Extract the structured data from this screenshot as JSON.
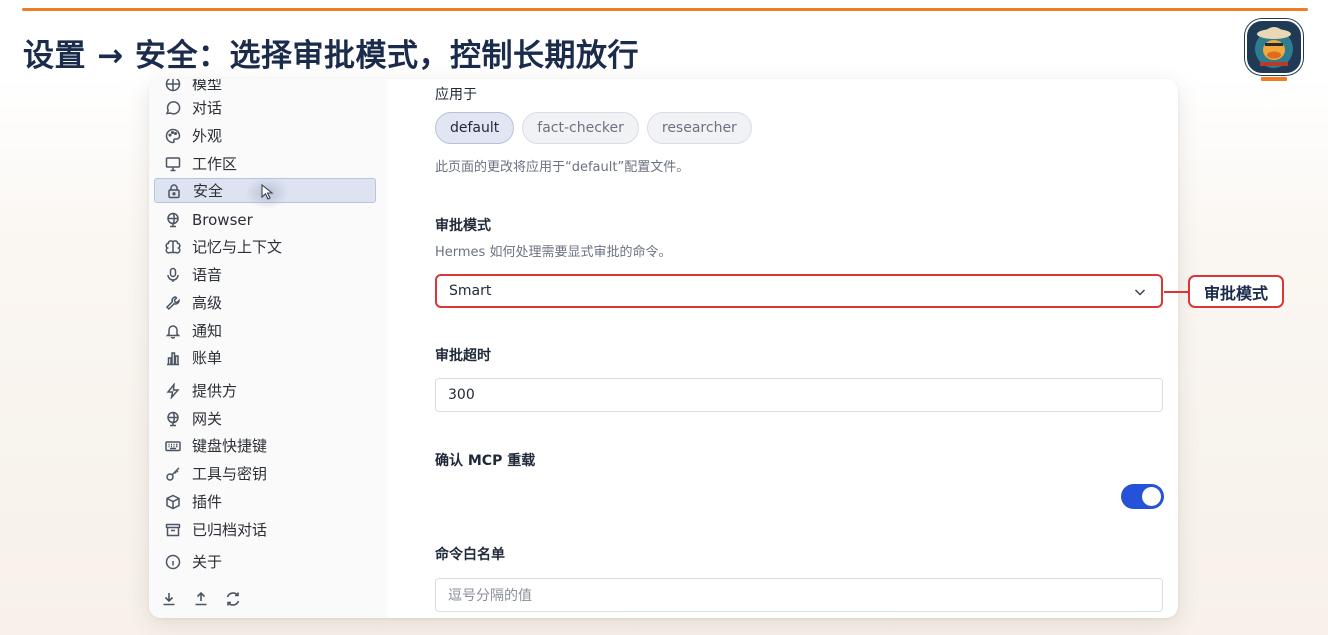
{
  "slide": {
    "title": "设置 → 安全：选择审批模式，控制长期放行",
    "accent_color": "#ee7d24",
    "callout_label": "审批模式",
    "callout_color": "#d93636"
  },
  "sidebar": {
    "items": [
      {
        "label": "模型",
        "icon": "model-icon"
      },
      {
        "label": "对话",
        "icon": "chat-bubble-icon"
      },
      {
        "label": "外观",
        "icon": "palette-icon"
      },
      {
        "label": "工作区",
        "icon": "monitor-icon"
      },
      {
        "label": "安全",
        "icon": "lock-icon",
        "active": true
      },
      {
        "label": "Browser",
        "icon": "globe-icon"
      },
      {
        "label": "记忆与上下文",
        "icon": "brain-icon"
      },
      {
        "label": "语音",
        "icon": "microphone-icon"
      },
      {
        "label": "高级",
        "icon": "wrench-icon"
      },
      {
        "label": "通知",
        "icon": "bell-icon"
      },
      {
        "label": "账单",
        "icon": "bar-chart-icon"
      },
      {
        "label": "提供方",
        "icon": "lightning-icon"
      },
      {
        "label": "网关",
        "icon": "globe-icon"
      },
      {
        "label": "键盘快捷键",
        "icon": "keyboard-icon"
      },
      {
        "label": "工具与密钥",
        "icon": "key-icon"
      },
      {
        "label": "插件",
        "icon": "package-icon"
      },
      {
        "label": "已归档对话",
        "icon": "archive-icon"
      },
      {
        "label": "关于",
        "icon": "info-icon"
      }
    ],
    "bottom_tools": [
      "download-icon",
      "upload-icon",
      "refresh-icon"
    ]
  },
  "main": {
    "applies_to_label": "应用于",
    "profiles": [
      {
        "label": "default",
        "active": true
      },
      {
        "label": "fact-checker",
        "active": false
      },
      {
        "label": "researcher",
        "active": false
      }
    ],
    "profile_hint": "此页面的更改将应用于“default”配置文件。",
    "approval_mode": {
      "label": "审批模式",
      "hint": "Hermes 如何处理需要显式审批的命令。",
      "value": "Smart"
    },
    "approval_timeout": {
      "label": "审批超时",
      "value": "300"
    },
    "confirm_mcp_reload": {
      "label": "确认 MCP 重载",
      "enabled": true,
      "toggle_color": "#2651d9"
    },
    "command_allowlist": {
      "label": "命令白名单",
      "placeholder": "逗号分隔的值"
    }
  }
}
